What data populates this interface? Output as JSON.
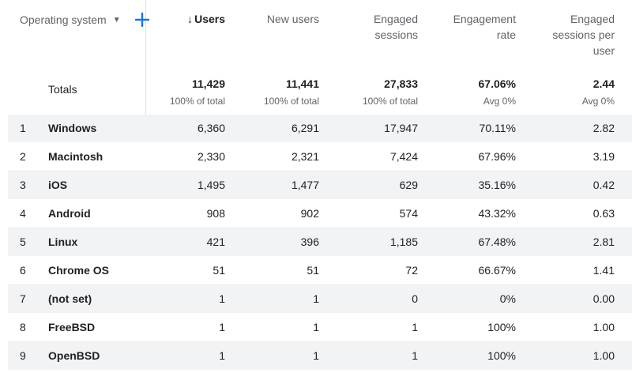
{
  "header": {
    "dimension_label": "Operating system",
    "caret_icon": "caret-down-icon",
    "add_icon": "plus-icon",
    "columns": [
      {
        "key": "users",
        "label": "Users",
        "sorted": true,
        "sort_icon": "arrow-down-icon"
      },
      {
        "key": "new_users",
        "label": "New users"
      },
      {
        "key": "engaged_sessions",
        "label": "Engaged sessions"
      },
      {
        "key": "engagement_rate",
        "label": "Engagement rate"
      },
      {
        "key": "engaged_per_user",
        "label": "Engaged sessions per user"
      }
    ]
  },
  "totals": {
    "label": "Totals",
    "values": [
      "11,429",
      "11,441",
      "27,833",
      "67.06%",
      "2.44"
    ],
    "subs": [
      "100% of total",
      "100% of total",
      "100% of total",
      "Avg 0%",
      "Avg 0%"
    ]
  },
  "rows": [
    {
      "idx": "1",
      "name": "Windows",
      "values": [
        "6,360",
        "6,291",
        "17,947",
        "70.11%",
        "2.82"
      ]
    },
    {
      "idx": "2",
      "name": "Macintosh",
      "values": [
        "2,330",
        "2,321",
        "7,424",
        "67.96%",
        "3.19"
      ]
    },
    {
      "idx": "3",
      "name": "iOS",
      "values": [
        "1,495",
        "1,477",
        "629",
        "35.16%",
        "0.42"
      ]
    },
    {
      "idx": "4",
      "name": "Android",
      "values": [
        "908",
        "902",
        "574",
        "43.32%",
        "0.63"
      ]
    },
    {
      "idx": "5",
      "name": "Linux",
      "values": [
        "421",
        "396",
        "1,185",
        "67.48%",
        "2.81"
      ]
    },
    {
      "idx": "6",
      "name": "Chrome OS",
      "values": [
        "51",
        "51",
        "72",
        "66.67%",
        "1.41"
      ]
    },
    {
      "idx": "7",
      "name": "(not set)",
      "values": [
        "1",
        "1",
        "0",
        "0%",
        "0.00"
      ]
    },
    {
      "idx": "8",
      "name": "FreeBSD",
      "values": [
        "1",
        "1",
        "1",
        "100%",
        "1.00"
      ]
    },
    {
      "idx": "9",
      "name": "OpenBSD",
      "values": [
        "1",
        "1",
        "1",
        "100%",
        "1.00"
      ]
    }
  ],
  "colors": {
    "accent": "#1a73e8",
    "row_alt": "#f1f3f4",
    "muted_text": "#5f6368"
  }
}
